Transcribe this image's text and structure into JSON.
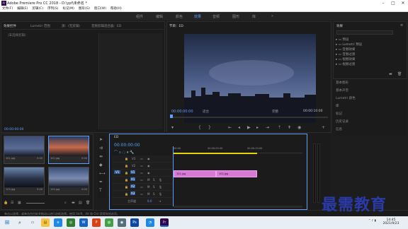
{
  "window": {
    "title": "Adobe Premiere Pro CC 2018 - D:\\ypf\\未命名 *",
    "logo": "Pr"
  },
  "menu": [
    "文件(F)",
    "编辑(E)",
    "剪辑(C)",
    "序列(S)",
    "标记(M)",
    "图形(G)",
    "窗口(W)",
    "帮助(H)"
  ],
  "workspaces": [
    {
      "label": "组件",
      "active": false
    },
    {
      "label": "编辑",
      "active": false
    },
    {
      "label": "颜色",
      "active": false
    },
    {
      "label": "效果",
      "active": true
    },
    {
      "label": "音频",
      "active": false
    },
    {
      "label": "图形",
      "active": false
    },
    {
      "label": "库",
      "active": false
    }
  ],
  "source_panel": {
    "tabs": [
      "效果控件",
      "Lumetri 范围",
      "源：(无剪辑)",
      "音频剪辑混合器：ED"
    ],
    "placeholder": "（未选择剪辑）",
    "time": "00:00:00:00"
  },
  "program": {
    "tab": "节目：ED",
    "timecode": "00:00:00:00",
    "fit": "适合",
    "quality": "完整",
    "duration": "00:00:10:00"
  },
  "effects": {
    "title": "效果",
    "items": [
      "预设",
      "Lumetri 预设",
      "音频效果",
      "音频过渡",
      "视频效果",
      "视频过渡"
    ]
  },
  "right_panels": [
    "基本图形",
    "基本声音",
    "Lumetri 颜色",
    "库",
    "标记",
    "历史记录",
    "信息"
  ],
  "project": {
    "items": [
      {
        "name": "101.jpg",
        "dur": "5:00"
      },
      {
        "name": "102.jpg",
        "dur": "5:00"
      },
      {
        "name": "103.jpg",
        "dur": "5:00"
      },
      {
        "name": "104.jpg",
        "dur": "5:00"
      }
    ]
  },
  "timeline": {
    "tab": "ED",
    "timecode": "00:00:00:00",
    "ruler": [
      "00:00",
      "00:00:05:00",
      "00:00:10:00"
    ],
    "video_tracks": [
      "V3",
      "V2",
      "V1"
    ],
    "audio_tracks": [
      "A1",
      "A2",
      "A3"
    ],
    "master": "主声道",
    "master_val": "0.0",
    "clips": [
      {
        "label": "101.jpg"
      },
      {
        "label": "102.jpg"
      }
    ]
  },
  "status": "单击以选择，或单击空白处并拖动以进行选框选择。使用 Shift、Alt 和 Ctrl 获得其他选项。",
  "watermark": "最需教育",
  "clock": {
    "time": "14:45",
    "date": "2021/9/23"
  },
  "colors": {
    "accent": "#5aa0ff",
    "clip": "#d67ad6",
    "yellow": "#e6d200"
  }
}
